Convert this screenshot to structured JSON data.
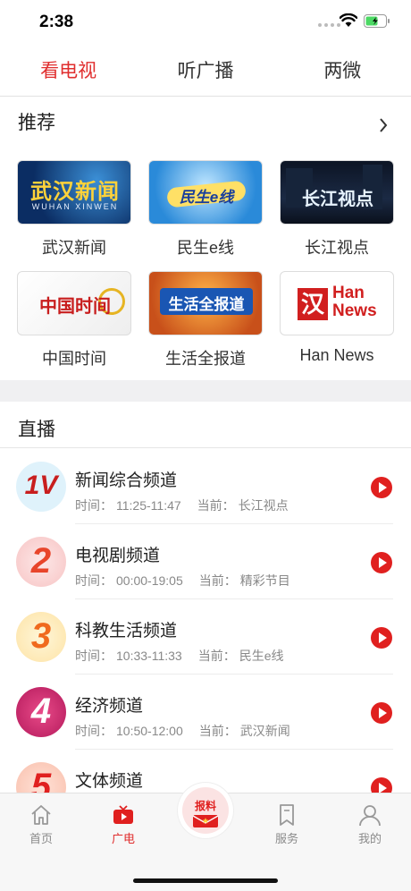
{
  "status_bar": {
    "time": "2:38"
  },
  "top_tabs": [
    {
      "label": "看电视",
      "active": true
    },
    {
      "label": "听广播",
      "active": false
    },
    {
      "label": "两微",
      "active": false
    }
  ],
  "recommend": {
    "title": "推荐",
    "items": [
      {
        "label": "武汉新闻",
        "thumb_text": "武汉新闻",
        "thumb_sub": "WUHAN XINWEN"
      },
      {
        "label": "民生e线",
        "thumb_text": "民生e线"
      },
      {
        "label": "长江视点",
        "thumb_text": "长江视点"
      },
      {
        "label": "中国时间",
        "thumb_text": "中国时间"
      },
      {
        "label": "生活全报道",
        "thumb_text": "生活全报道"
      },
      {
        "label": "Han News",
        "thumb_text_cn": "汉",
        "thumb_text_en1": "Han",
        "thumb_text_en2": "News"
      }
    ]
  },
  "live": {
    "title": "直播",
    "channels": [
      {
        "name": "新闻综合频道",
        "time_label": "时间：",
        "time": "11:25-11:47",
        "current_label": "当前：",
        "current": "长江视点",
        "logo_text": "1V"
      },
      {
        "name": "电视剧频道",
        "time_label": "时间：",
        "time": "00:00-19:05",
        "current_label": "当前：",
        "current": "精彩节目",
        "logo_text": "2"
      },
      {
        "name": "科教生活频道",
        "time_label": "时间：",
        "time": "10:33-11:33",
        "current_label": "当前：",
        "current": "民生e线",
        "logo_text": "3"
      },
      {
        "name": "经济频道",
        "time_label": "时间：",
        "time": "10:50-12:00",
        "current_label": "当前：",
        "current": "武汉新闻",
        "logo_text": "4"
      },
      {
        "name": "文体频道",
        "time_label": "",
        "time": "",
        "current_label": "",
        "current": "",
        "logo_text": "5"
      }
    ]
  },
  "bottom_nav": {
    "items": [
      {
        "label": "首页",
        "icon": "home-icon",
        "active": false
      },
      {
        "label": "广电",
        "icon": "tv-icon",
        "active": true
      },
      {
        "label": "服务",
        "icon": "bookmark-icon",
        "active": false
      },
      {
        "label": "我的",
        "icon": "user-icon",
        "active": false
      }
    ],
    "report_label": "报料"
  },
  "colors": {
    "accent": "#e02e2e",
    "play": "#e0201f"
  }
}
